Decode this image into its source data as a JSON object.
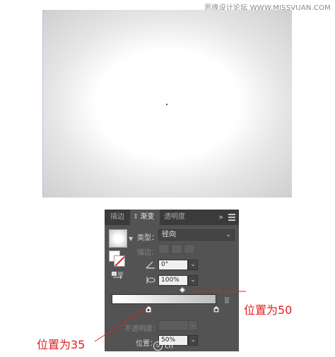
{
  "watermark": "思缘设计论坛  WWW.MISSVUAN.COM",
  "panel": {
    "tabs": [
      {
        "label": "描边",
        "active": false
      },
      {
        "label": "渐变",
        "active": true
      },
      {
        "label": "透明度",
        "active": false
      }
    ],
    "collapse_label": "»",
    "type_label": "类型：",
    "type_value": "径向",
    "stroke_label": "描边：",
    "angle_value": "0°",
    "aspect_value": "100%",
    "opacity_label": "不透明度：",
    "position_label": "位置：",
    "position_value": "50%",
    "logo_text": "cn"
  },
  "callouts": {
    "position_50": "位置为50",
    "position_35": "位置为35"
  },
  "colors": {
    "panel_bg": "#535353",
    "callout": "#e02020"
  }
}
